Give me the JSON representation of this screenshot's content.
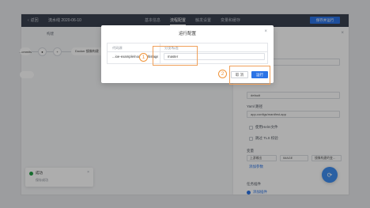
{
  "topbar": {
    "back_label": "返回",
    "crumb": "流水线 2020-06-10",
    "tabs": [
      "基本信息",
      "流程配置",
      "触发设置",
      "变量和缓存"
    ],
    "active_tab": "流程配置",
    "run_label": "保存并运行"
  },
  "canvas": {
    "stage_label": "构建",
    "docker_node": "Docker 镜像构建",
    "nodes_partial": [
      "...ommits"
    ]
  },
  "toast": {
    "title": "成功",
    "message": "保存成功"
  },
  "panel": {
    "section_a": "Yaml 路径",
    "input_path": "app-configs/manifest-app",
    "input_default": "default",
    "checkbox_1": "使用Helm文件",
    "checkbox_2": "跳过 TLS 校验",
    "vars_label": "变量",
    "var_cells": [
      "上游输出",
      "IMAGE",
      "镜像构建的变..."
    ],
    "add_var_link": "添加参数",
    "task_section": "任务插件",
    "radio_label": "添加插件"
  },
  "modal": {
    "title": "运行配置",
    "col_repo": "代码源",
    "col_branch": "分支/标签",
    "repo_value": "...ioe-example/node-multistage",
    "branch_value": "master",
    "cancel_label": "取 消",
    "confirm_label": "运行"
  },
  "annotations": {
    "badge_1": "1",
    "badge_2": "2",
    "highlight_color": "#f0a05a"
  },
  "colors": {
    "primary": "#2c74e6",
    "topbar": "#3a4150",
    "success": "#22a045"
  }
}
